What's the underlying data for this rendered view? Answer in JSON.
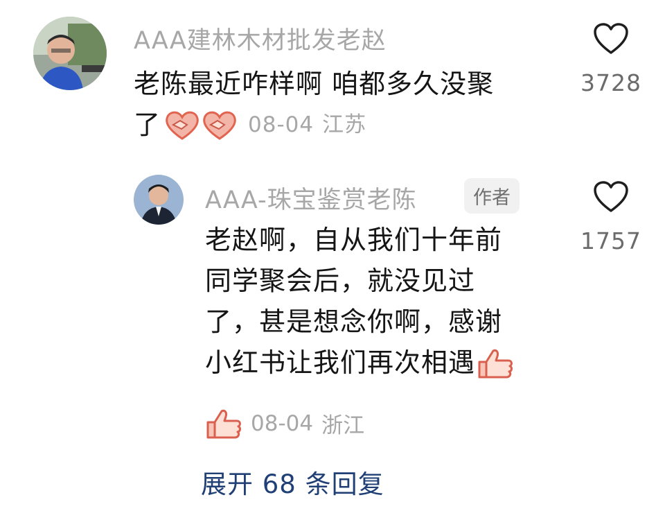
{
  "comments": [
    {
      "username": "AAA建林木材批发老赵",
      "text_lines": [
        "老陈最近咋样啊 咱都多久没聚",
        "了"
      ],
      "date": "08-04",
      "location": "江苏",
      "likes": "3728",
      "emoji": "handshake-heart-emoji"
    },
    {
      "username": "AAA-珠宝鉴赏老陈",
      "badge": "作者",
      "text_lines": [
        "老赵啊，自从我们十年前",
        "同学聚会后，就没见过",
        "了，甚是想念你啊，感谢",
        "小红书让我们再次相遇"
      ],
      "date": "08-04",
      "location": "浙江",
      "likes": "1757",
      "emoji": "thumbs-up-emoji"
    }
  ],
  "expand_replies": "展开 68 条回复",
  "colors": {
    "username": "#a7a7a7",
    "text": "#151515",
    "expand_link": "#1f3f75",
    "emoji": "#f08a8a"
  }
}
